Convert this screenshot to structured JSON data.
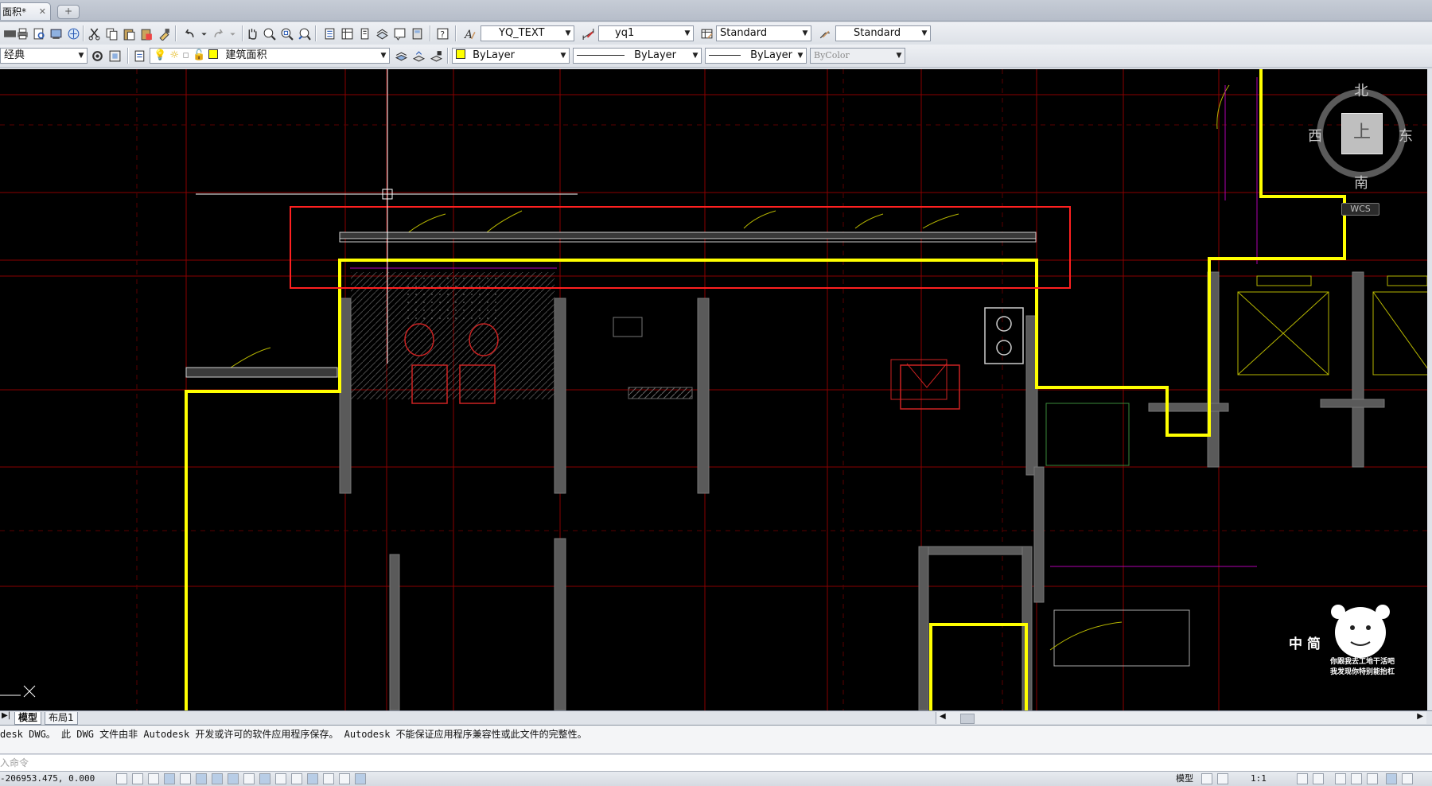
{
  "tab": {
    "title": "面积*",
    "close_glyph": "✕",
    "new_glyph": "+"
  },
  "toolbar1": {
    "text_style": "YQ_TEXT",
    "dim_style": "yq1",
    "table_style": "Standard",
    "multileader_style": "Standard"
  },
  "toolbar2": {
    "workspace": "经典",
    "layer": "建筑面积",
    "color": "ByLayer",
    "linetype": "ByLayer",
    "lineweight": "ByLayer",
    "plotstyle": "ByColor"
  },
  "viewcube": {
    "north": "北",
    "south": "南",
    "east": "东",
    "west": "西",
    "face": "上",
    "wcs": "WCS"
  },
  "watermark": {
    "line1": "你跟我去工地干活吧",
    "line2": "我发现你特别能抬杠",
    "big": "中 简"
  },
  "layout_tabs": {
    "model": "模型",
    "layout1": "布局1"
  },
  "command": {
    "history": "desk DWG。  此 DWG 文件由非 Autodesk 开发或许可的软件应用程序保存。  Autodesk 不能保证应用程序兼容性或此文件的完整性。",
    "placeholder": "入命令"
  },
  "status": {
    "coords": "-206953.475, 0.000",
    "model_label": "模型",
    "scale": "1:1"
  },
  "colors": {
    "canvas": "#000000",
    "highlight": "#ffff00",
    "selection": "#ff0000",
    "grid": "#aa0000"
  }
}
